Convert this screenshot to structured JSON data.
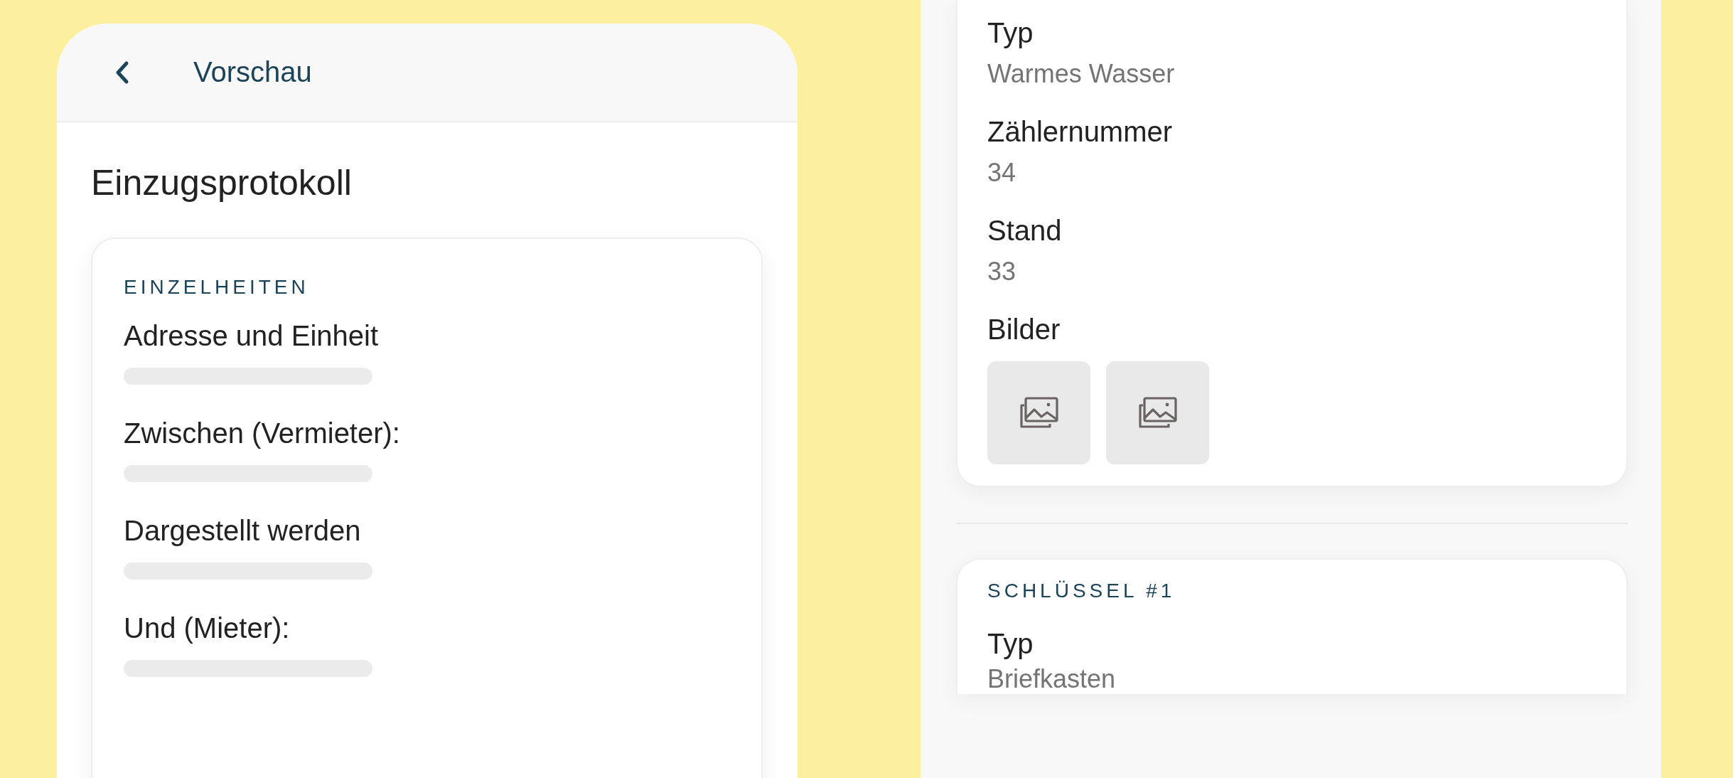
{
  "preview": {
    "header": {
      "title": "Vorschau"
    },
    "title": "Einzugsprotokoll",
    "section": {
      "heading": "EINZELHEITEN",
      "fields": [
        {
          "label": "Adresse und Einheit",
          "loading": true
        },
        {
          "label": "Zwischen (Vermieter):",
          "loading": true
        },
        {
          "label": "Dargestellt werden",
          "loading": true
        },
        {
          "label": "Und (Mieter):",
          "loading": true
        }
      ]
    }
  },
  "meter": {
    "fields": [
      {
        "label": "Typ",
        "value": "Warmes Wasser"
      },
      {
        "label": "Zählernummer",
        "value": "34"
      },
      {
        "label": "Stand",
        "value": "33"
      }
    ],
    "images": {
      "label": "Bilder",
      "thumbnails": [
        {
          "kind": "image"
        },
        {
          "kind": "image"
        }
      ]
    }
  },
  "key_section": {
    "heading": "SCHLÜSSEL #1",
    "fields": [
      {
        "label": "Typ",
        "value": "Briefkasten"
      }
    ]
  }
}
